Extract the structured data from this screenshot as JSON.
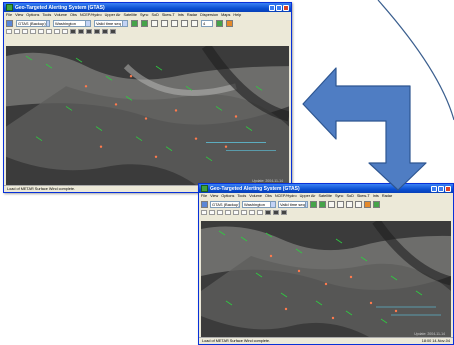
{
  "app": {
    "title": "Geo-Targeted Alerting System (GTAS)"
  },
  "menu": [
    "File",
    "View",
    "Options",
    "Tools",
    "Volume",
    "Obs",
    "NCEP/Hydro",
    "Upper Air",
    "Satellite",
    "Sync",
    "SoD",
    "Skew-T",
    "Ints",
    "Radar",
    "Dispersion",
    "Maps",
    "Help"
  ],
  "toolbar": {
    "scale": "GTAS (Backup)",
    "location": "Washington",
    "time_mode": "Valid time seq",
    "frame_count": "4"
  },
  "statusbar": {
    "message": "Load of METAR Surface Wind complete.",
    "time": "18:00 14-Nov-04"
  },
  "map": {
    "update_text": "Update: 2004-11-14",
    "colors": {
      "background": "#3b3b3b",
      "winds_green": "#2ecc40",
      "plot_orange": "#ff7a4d",
      "label_cyan": "#5fe0ff"
    }
  },
  "colors": {
    "arrow_fill": "#4f7dc3",
    "arrow_stroke": "#2e5691",
    "arc_stroke": "#3a5e8e",
    "titlebar": "#0a4fd1"
  }
}
